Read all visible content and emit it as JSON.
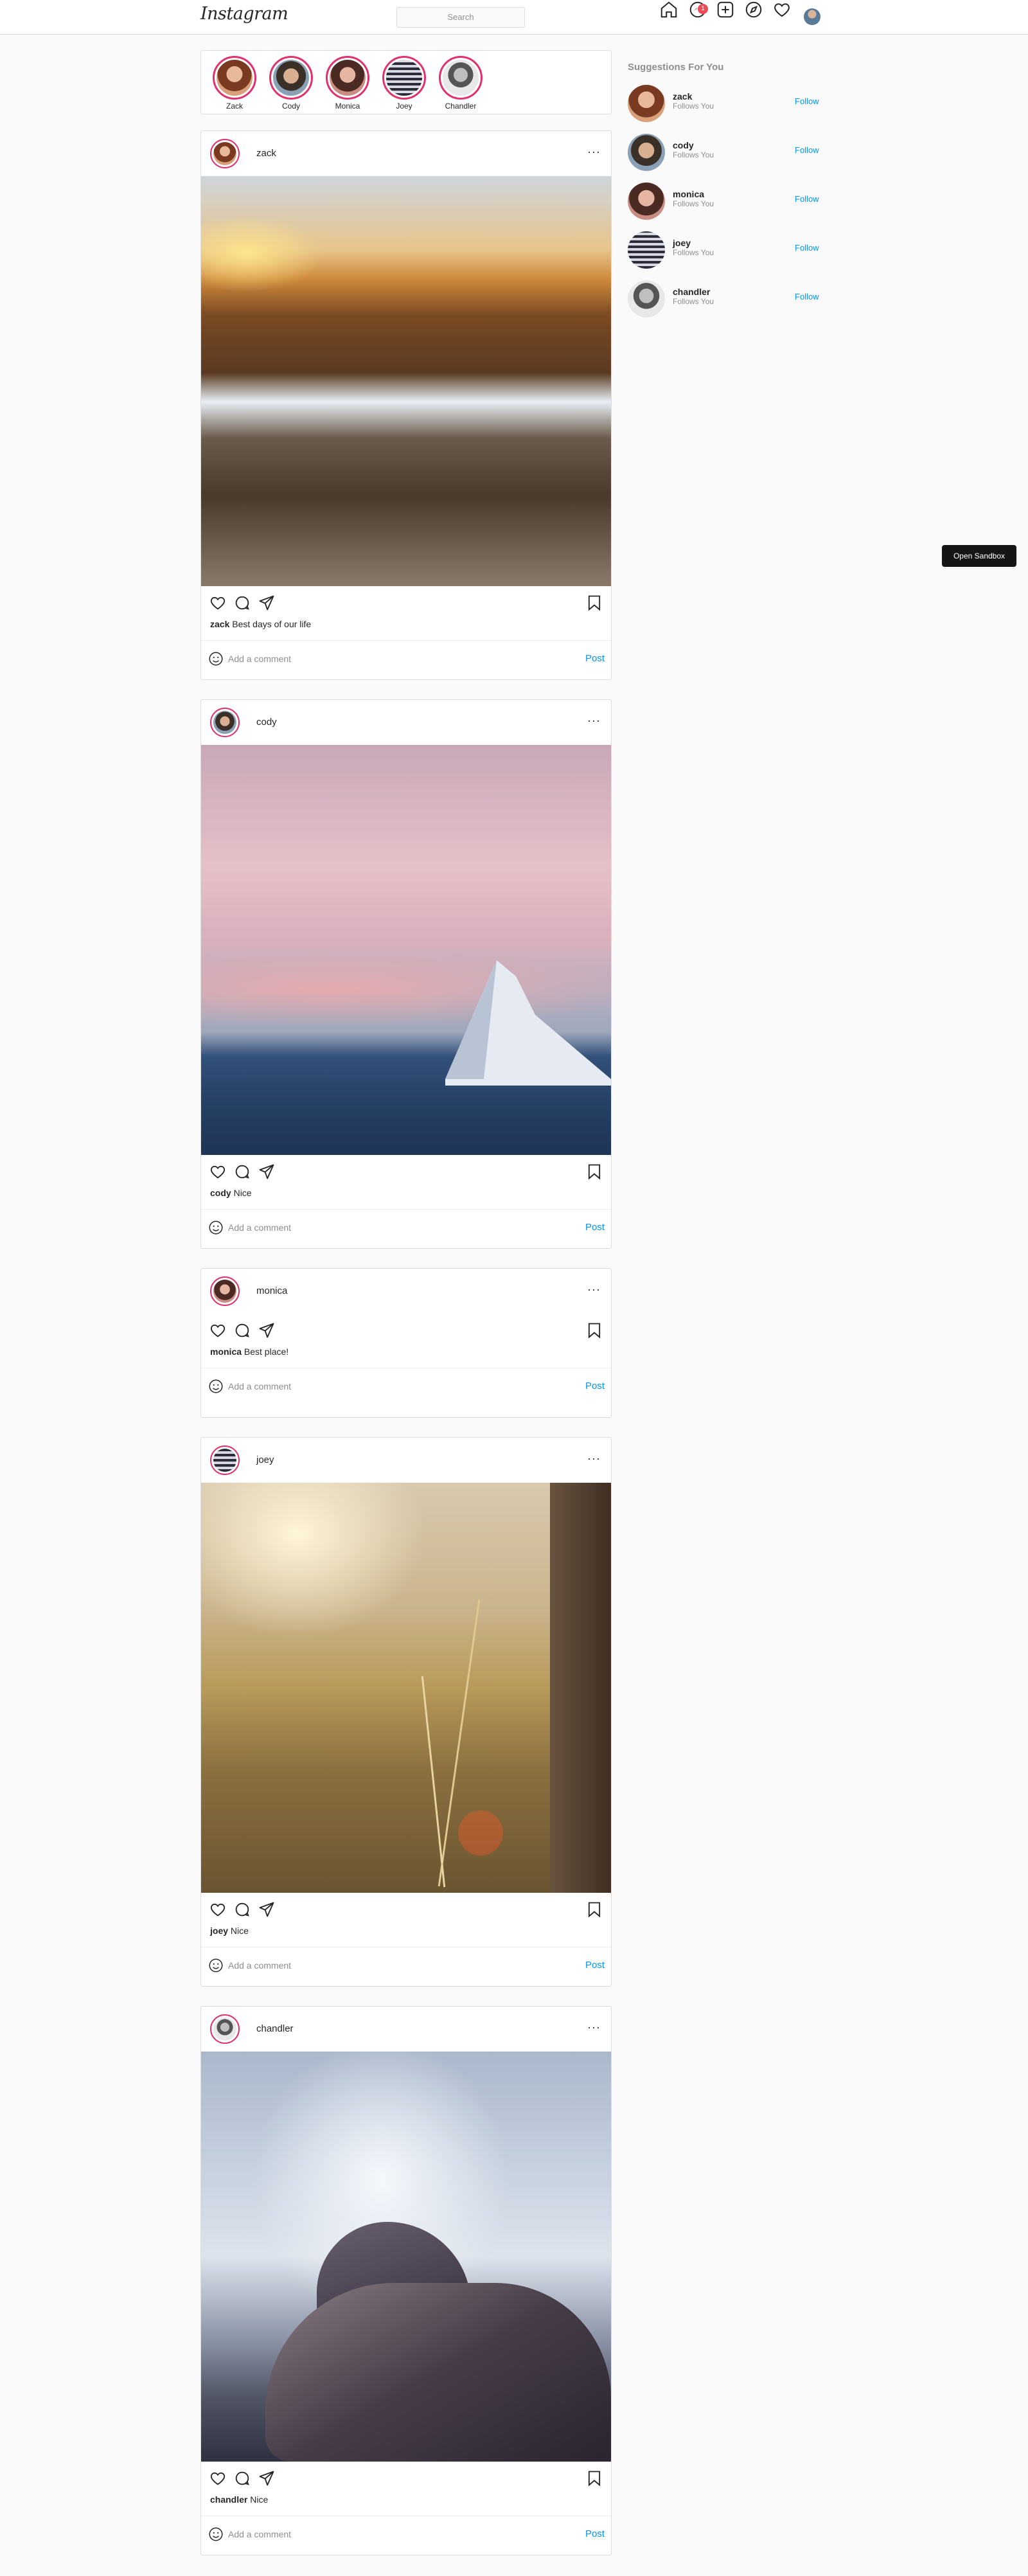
{
  "header": {
    "logo": "Instagram",
    "search_placeholder": "Search",
    "notification_count": "1",
    "icons": [
      "home-icon",
      "messenger-icon",
      "new-post-icon",
      "explore-icon",
      "activity-heart-icon",
      "profile-avatar"
    ]
  },
  "stories": [
    {
      "name": "Zack"
    },
    {
      "name": "Cody"
    },
    {
      "name": "Monica"
    },
    {
      "name": "Joey"
    },
    {
      "name": "Chandler"
    }
  ],
  "suggestions": {
    "title": "Suggestions For You",
    "items": [
      {
        "name": "zack",
        "sub": "Follows You",
        "action": "Follow"
      },
      {
        "name": "cody",
        "sub": "Follows You",
        "action": "Follow"
      },
      {
        "name": "monica",
        "sub": "Follows You",
        "action": "Follow"
      },
      {
        "name": "joey",
        "sub": "Follows You",
        "action": "Follow"
      },
      {
        "name": "chandler",
        "sub": "Follows You",
        "action": "Follow"
      }
    ]
  },
  "sandbox_button": "Open Sandbox",
  "posts": [
    {
      "user": "zack",
      "more": "···",
      "caption_user": "zack",
      "caption_text": "Best days of our life",
      "comment_placeholder": "Add a comment",
      "post_label": "Post"
    },
    {
      "user": "cody",
      "more": "···",
      "caption_user": "cody",
      "caption_text": "Nice",
      "comment_placeholder": "Add a comment",
      "post_label": "Post"
    },
    {
      "user": "monica",
      "more": "···",
      "caption_user": "monica",
      "caption_text": "Best place!",
      "comment_placeholder": "Add a comment",
      "post_label": "Post"
    },
    {
      "user": "joey",
      "more": "···",
      "caption_user": "joey",
      "caption_text": "Nice",
      "comment_placeholder": "Add a comment",
      "post_label": "Post"
    },
    {
      "user": "chandler",
      "more": "···",
      "caption_user": "chandler",
      "caption_text": "Nice",
      "comment_placeholder": "Add a comment",
      "post_label": "Post"
    }
  ],
  "colors": {
    "link": "#0095f6",
    "story_ring": "#e1306c",
    "badge": "#ed4956"
  }
}
